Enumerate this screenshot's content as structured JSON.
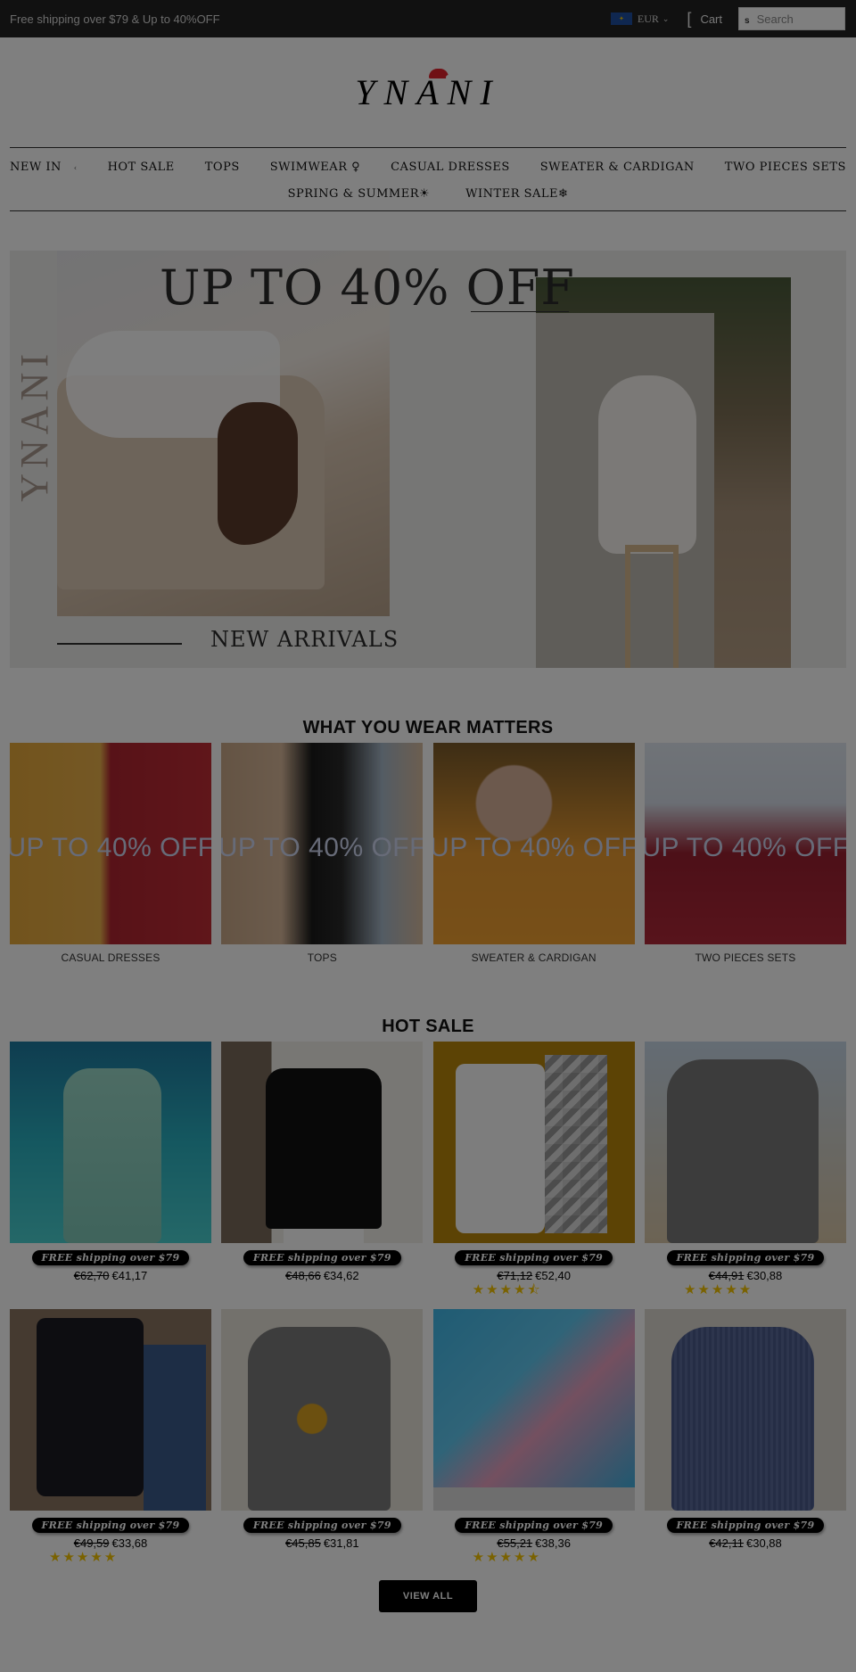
{
  "topbar": {
    "promo": "Free shipping over $79 & Up to 40%OFF",
    "currency": {
      "code": "EUR",
      "flag_icon": "eu-flag-icon"
    },
    "cart_label": "Cart",
    "search_placeholder": "Search",
    "search_icon_glyph": "s"
  },
  "logo": {
    "text": "YNANI"
  },
  "nav": {
    "row1": [
      {
        "label": "NEW IN",
        "has_submenu": true
      },
      {
        "label": "HOT SALE"
      },
      {
        "label": "TOPS"
      },
      {
        "label": "SWIMWEAR ♀"
      },
      {
        "label": "CASUAL DRESSES"
      },
      {
        "label": "SWEATER & CARDIGAN"
      },
      {
        "label": "TWO PIECES SETS"
      }
    ],
    "row2": [
      {
        "label": "SPRING & SUMMER☀"
      },
      {
        "label": "WINTER SALE❄"
      }
    ]
  },
  "hero": {
    "headline": "UP TO 40% OFF",
    "subheadline": "NEW ARRIVALS",
    "side_brand": "YNANI"
  },
  "categories": {
    "title": "WHAT YOU WEAR MATTERS",
    "overlay_text": "UP TO 40% OFF",
    "items": [
      {
        "label": "CASUAL DRESSES"
      },
      {
        "label": "TOPS"
      },
      {
        "label": "SWEATER & CARDIGAN"
      },
      {
        "label": "TWO PIECES SETS"
      }
    ]
  },
  "hot_sale": {
    "title": "HOT SALE",
    "badge": "FREE shipping over $79",
    "products": [
      {
        "old_price": "€62,70",
        "price": "€41,17",
        "stars": ""
      },
      {
        "old_price": "€48,66",
        "price": "€34,62",
        "stars": ""
      },
      {
        "old_price": "€71,12",
        "price": "€52,40",
        "stars": "★★★★⯪",
        "rating": 4.5
      },
      {
        "old_price": "€44,91",
        "price": "€30,88",
        "stars": "★★★★★",
        "rating": 5
      },
      {
        "old_price": "€49,59",
        "price": "€33,68",
        "stars": "★★★★★",
        "rating": 5
      },
      {
        "old_price": "€45,85",
        "price": "€31,81",
        "stars": ""
      },
      {
        "old_price": "€55,21",
        "price": "€38,36",
        "stars": "★★★★★",
        "rating": 5
      },
      {
        "old_price": "€42,11",
        "price": "€30,88",
        "stars": ""
      }
    ],
    "view_all_label": "VIEW ALL"
  },
  "colors": {
    "topbar_bg": "#222222",
    "badge_bg": "#000000",
    "star": "#f5c400",
    "overlay": "rgba(0,0,0,0.5)"
  }
}
